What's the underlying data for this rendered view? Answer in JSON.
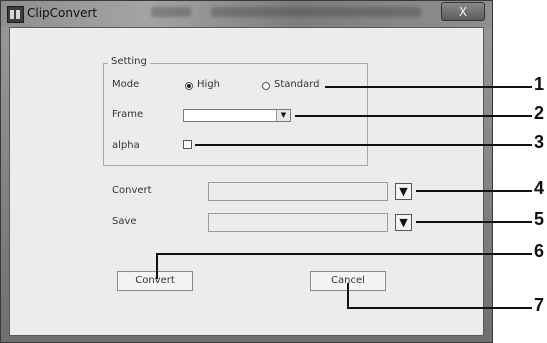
{
  "window": {
    "title": "ClipConvert",
    "close_label": "X"
  },
  "setting": {
    "group_label": "Setting",
    "mode_label": "Mode",
    "mode_options": [
      "High",
      "Standard"
    ],
    "mode_selected": "High",
    "frame_label": "Frame",
    "frame_value": "",
    "alpha_label": "alpha",
    "alpha_checked": false
  },
  "paths": {
    "convert_label": "Convert",
    "convert_value": "",
    "save_label": "Save",
    "save_value": ""
  },
  "buttons": {
    "convert": "Convert",
    "cancel": "Cancel"
  },
  "callouts": [
    "1",
    "2",
    "3",
    "4",
    "5",
    "6",
    "7"
  ]
}
